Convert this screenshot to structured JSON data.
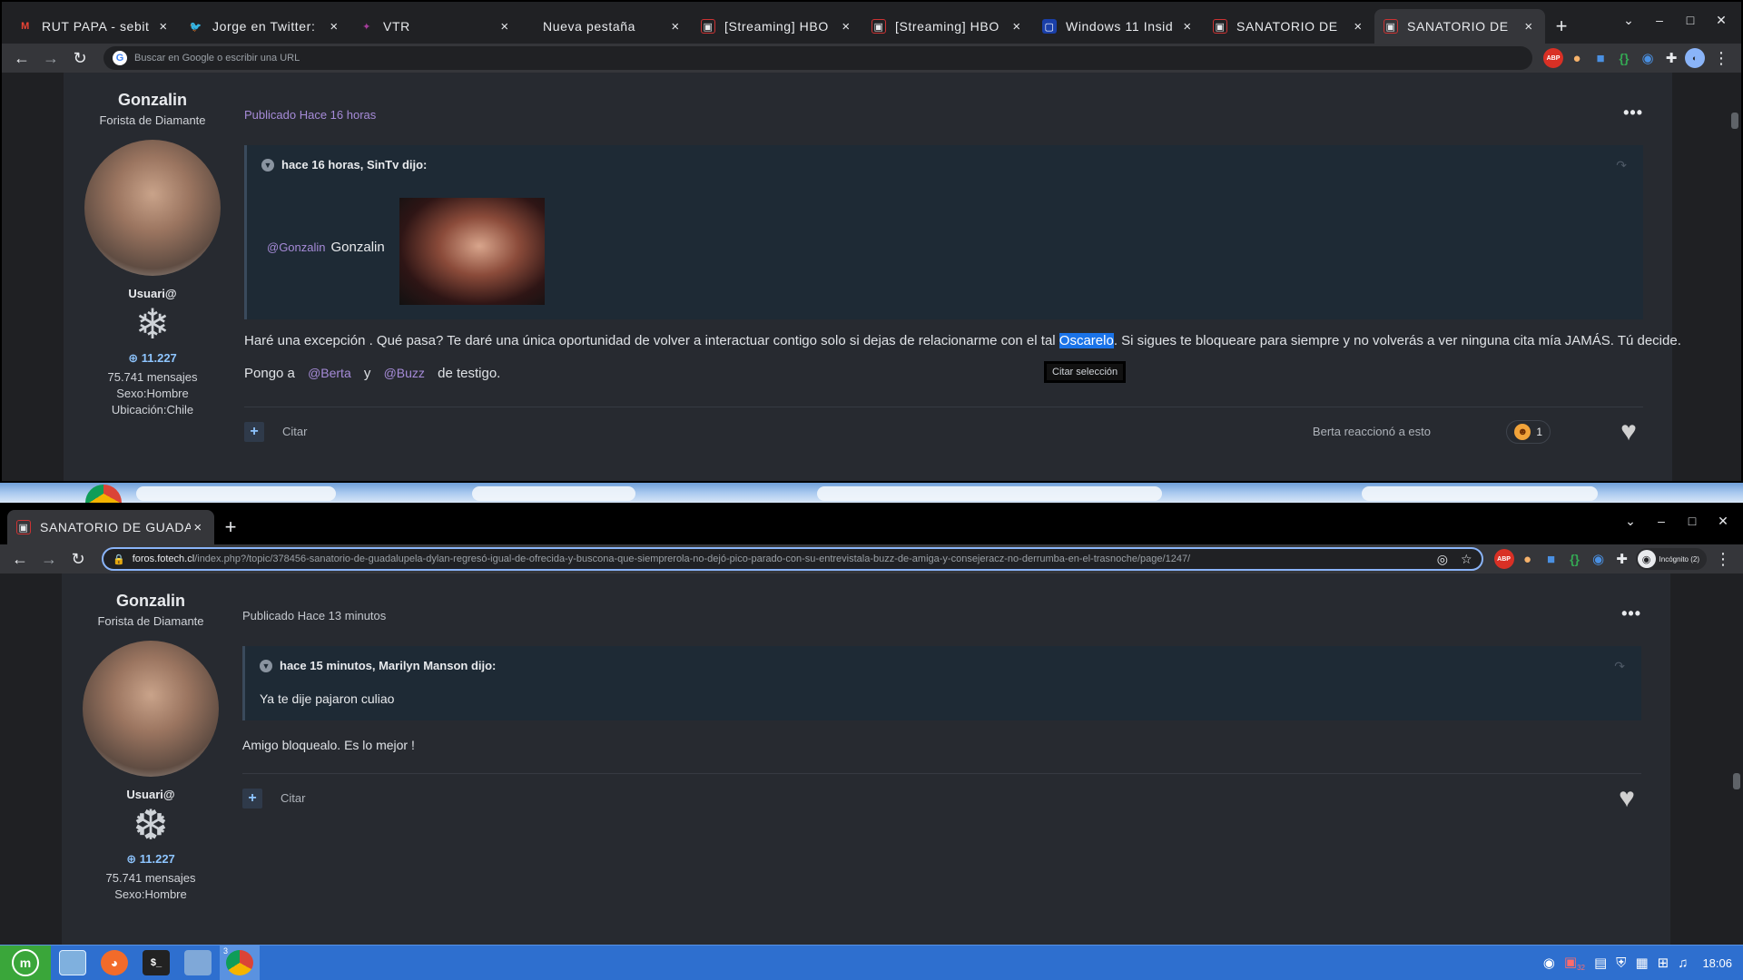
{
  "top_window": {
    "tabs": [
      {
        "label": "RUT PAPA - sebit",
        "favicon": "gmail-icon"
      },
      {
        "label": "Jorge en Twitter:",
        "favicon": "twitter-icon"
      },
      {
        "label": "VTR",
        "favicon": "vtr-icon"
      },
      {
        "label": "Nueva pestaña",
        "favicon": ""
      },
      {
        "label": "[Streaming] HBO",
        "favicon": "forum-icon"
      },
      {
        "label": "[Streaming] HBO",
        "favicon": "forum-icon"
      },
      {
        "label": "Windows 11 Insid",
        "favicon": "windows-insider-icon"
      },
      {
        "label": "SANATORIO DE",
        "favicon": "forum-icon"
      },
      {
        "label": "SANATORIO DE",
        "favicon": "forum-icon",
        "active": true
      }
    ],
    "omnibox_placeholder": "Buscar en Google o escribir una URL",
    "post": {
      "author": "Gonzalin",
      "rank": "Forista de Diamante",
      "group": "Usuari@",
      "reputation": "11.227",
      "messages": "75.741 mensajes",
      "sex": "Sexo:Hombre",
      "location": "Ubicación:Chile",
      "published": "Publicado Hace 16 horas",
      "quote_header": "hace 16 horas, SinTv dijo:",
      "quote_mention": "@Gonzalin",
      "quote_text": "Gonzalin",
      "body_before": "Haré una excepción . Qué pasa? Te daré una única oportunidad de volver a interactuar contigo solo si dejas de relacionarme con el tal ",
      "body_highlight": "Oscarelo",
      "body_after": ". Si sigues te bloqueare para siempre y no volverás a ver ninguna cita mía JAMÁS.  Tú decide.",
      "line2_prefix": "Pongo a",
      "mention_1": "@Berta",
      "line2_and": "y",
      "mention_2": "@Buzz",
      "line2_suffix": "de testigo.",
      "tooltip": "Citar selección",
      "cite_label": "Citar",
      "reaction_text": "Berta reaccionó a esto",
      "reaction_count": "1"
    }
  },
  "bottom_window": {
    "tab_label": "SANATORIO DE GUADAL",
    "url_host": "foros.fotech.cl",
    "url_path": "/index.php?/topic/378456-sanatorio-de-guadalupela-dylan-regresó-igual-de-ofrecida-y-buscona-que-siemprerola-no-dejó-pico-parado-con-su-entrevistala-buzz-de-amiga-y-consejeracz-no-derrumba-en-el-trasnoche/page/1247/",
    "incognito_label": "Incógnito (2)",
    "post": {
      "author": "Gonzalin",
      "rank": "Forista de Diamante",
      "group": "Usuari@",
      "reputation": "11.227",
      "messages": "75.741 mensajes",
      "sex": "Sexo:Hombre",
      "published": "Publicado Hace 13 minutos",
      "quote_header": "hace 15 minutos, Marilyn Manson dijo:",
      "quote_text": "Ya te dije pajaron culiao",
      "body": "Amigo bloquealo.  Es lo mejor !",
      "cite_label": "Citar"
    }
  },
  "taskbar": {
    "chrome_window_count": "3",
    "clock": "18:06",
    "tray_badge": "32"
  }
}
